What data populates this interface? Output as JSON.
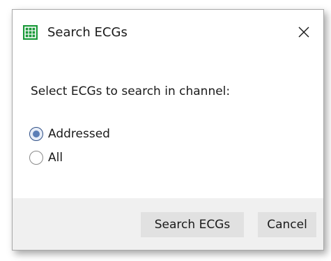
{
  "dialog": {
    "title": "Search ECGs",
    "icon": "grid-app-icon",
    "close_icon": "close-icon"
  },
  "content": {
    "prompt": "Select ECGs to search in channel:",
    "options": [
      {
        "label": "Addressed",
        "selected": true
      },
      {
        "label": "All",
        "selected": false
      }
    ]
  },
  "footer": {
    "search_label": "Search ECGs",
    "cancel_label": "Cancel"
  },
  "colors": {
    "icon_green": "#1b9a3a",
    "radio_accent": "#5b7eb6",
    "button_bg": "#e1e1e1",
    "footer_bg": "#f0f0f0"
  }
}
